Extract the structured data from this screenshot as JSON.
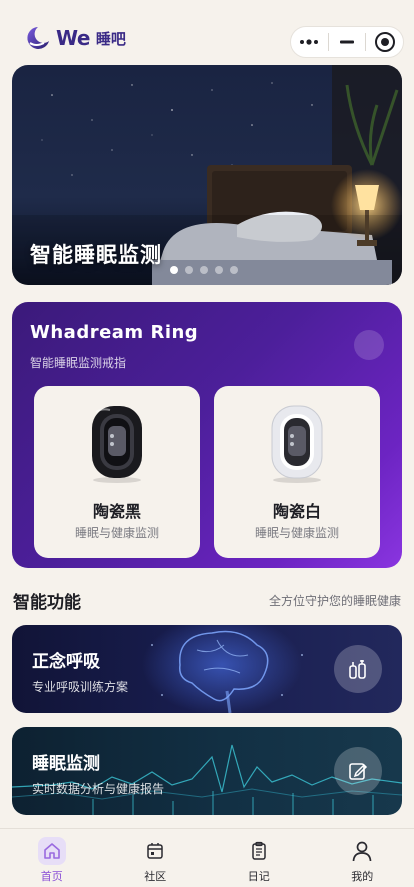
{
  "header": {
    "logo_word": "We",
    "logo_cn": "睡吧",
    "capsule": {
      "more_icon": "more-dots-icon",
      "minimize_icon": "minimize-icon",
      "close_icon": "target-close-icon"
    }
  },
  "banner": {
    "title": "智能睡眠监测",
    "slides_total": 5,
    "active_slide": 1
  },
  "ring_card": {
    "title": "Whadream Ring",
    "subtitle": "智能睡眠监测戒指",
    "products": [
      {
        "name": "陶瓷黑",
        "desc": "睡眠与健康监测",
        "color": "#1a1a1e"
      },
      {
        "name": "陶瓷白",
        "desc": "睡眠与健康监测",
        "color": "#f0f0f2"
      }
    ]
  },
  "section": {
    "title": "智能功能",
    "subtitle": "全方位守护您的睡眠健康"
  },
  "features": [
    {
      "title": "正念呼吸",
      "desc": "专业呼吸训练方案",
      "icon": "breathing-icon"
    },
    {
      "title": "睡眠监测",
      "desc": "实时数据分析与健康报告",
      "icon": "edit-icon"
    }
  ],
  "tabbar": {
    "items": [
      {
        "label": "首页",
        "icon": "home-icon",
        "active": true
      },
      {
        "label": "社区",
        "icon": "community-icon",
        "active": false
      },
      {
        "label": "日记",
        "icon": "diary-icon",
        "active": false
      },
      {
        "label": "我的",
        "icon": "profile-icon",
        "active": false
      }
    ]
  },
  "colors": {
    "accent": "#8a4fd6",
    "brand": "#3a2a86",
    "background": "#f6f2ec"
  }
}
